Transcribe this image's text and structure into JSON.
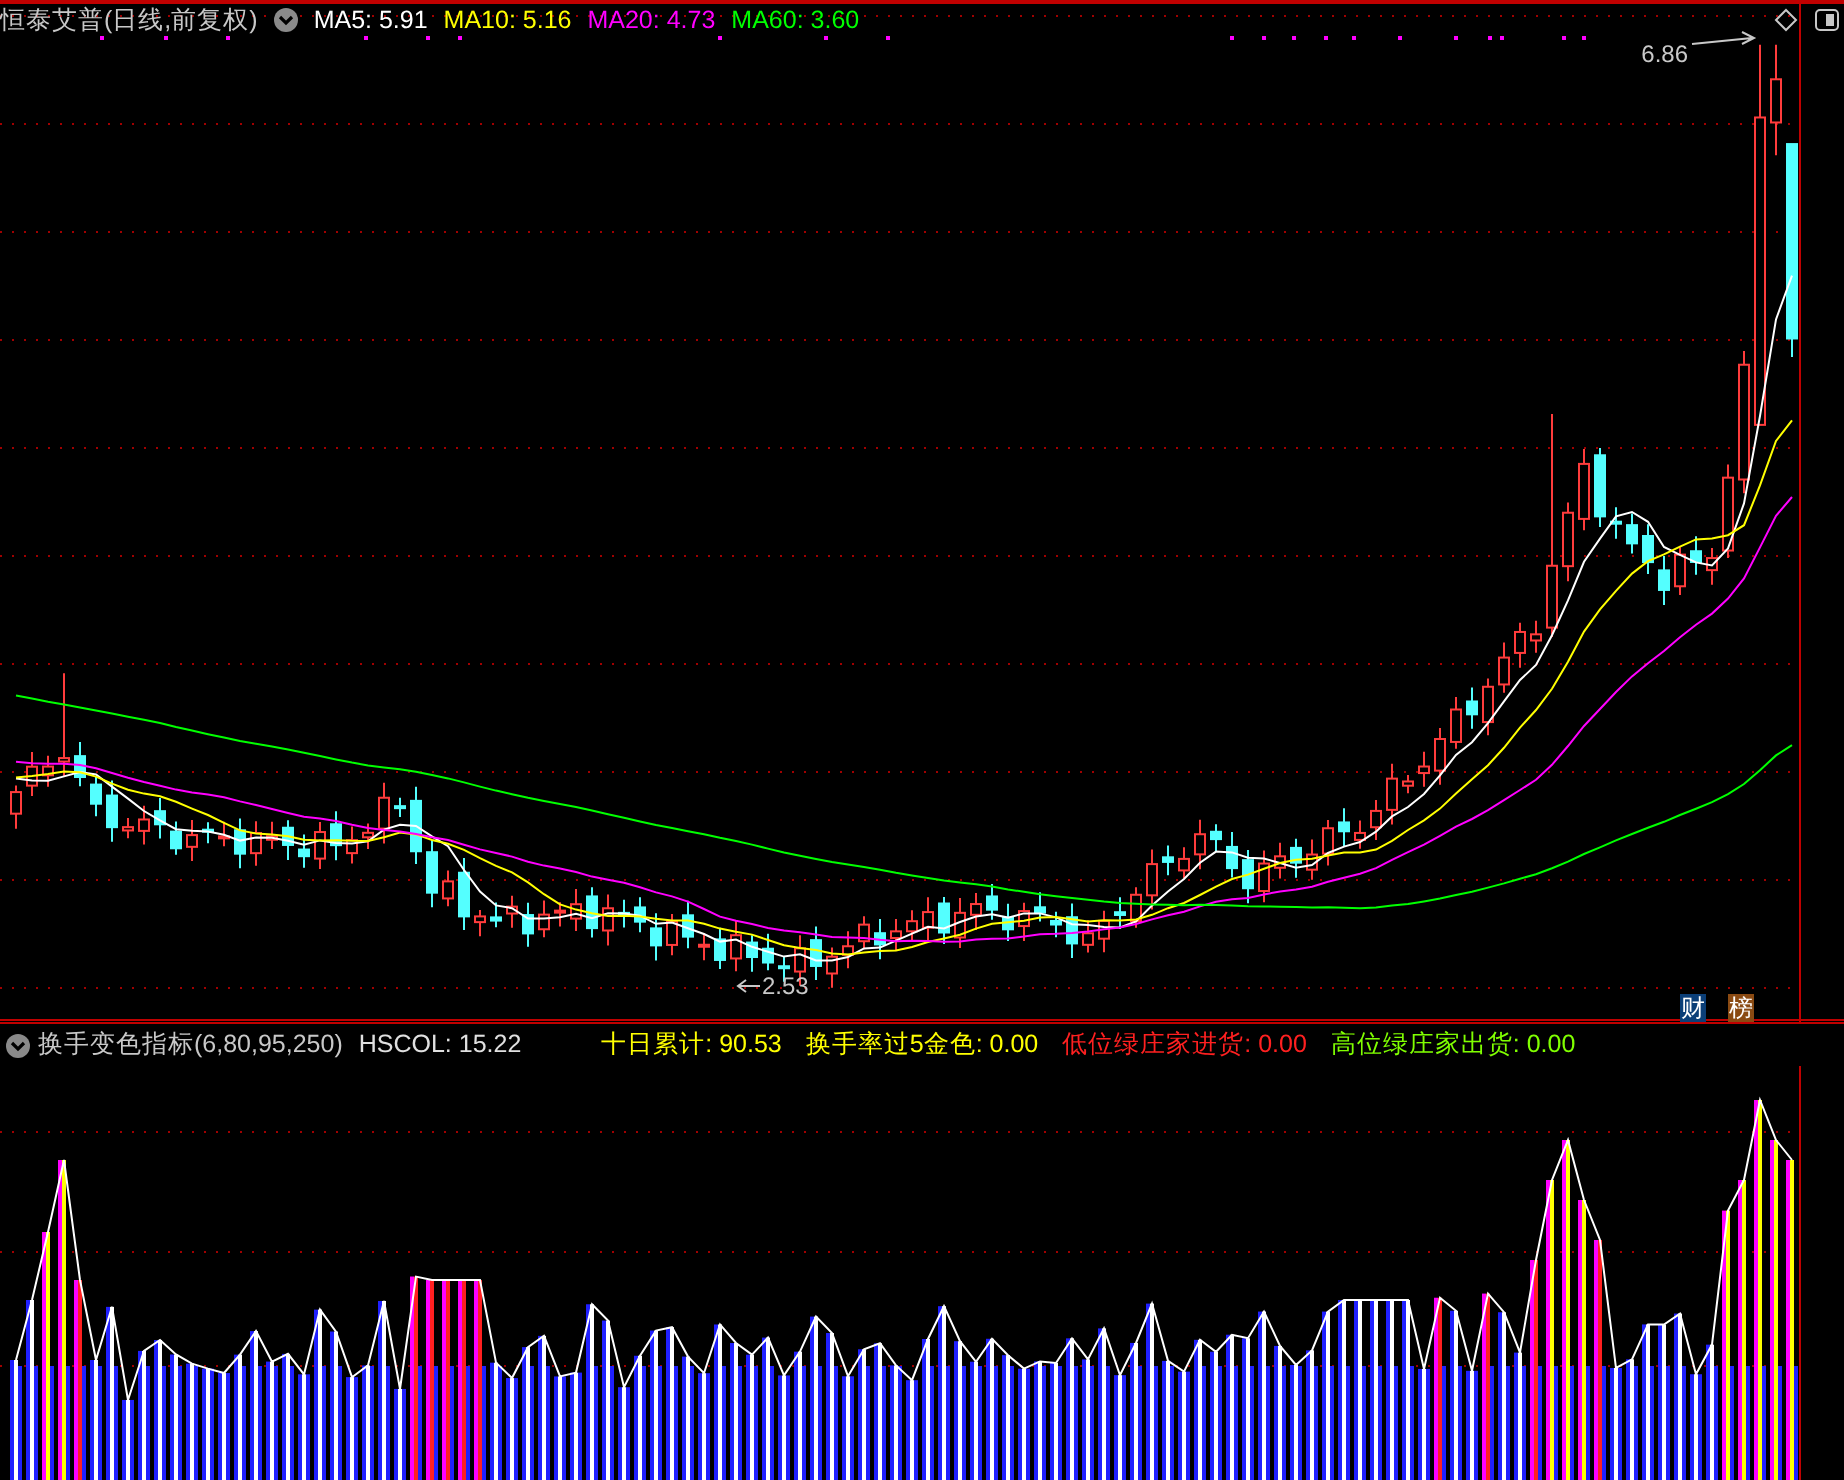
{
  "chart_header": {
    "title": "恒泰艾普(日线,前复权)",
    "moving_averages": [
      {
        "text": "MA5: 5.91",
        "color": "#ffffff"
      },
      {
        "text": "MA10: 5.16",
        "color": "#ffff00"
      },
      {
        "text": "MA20: 4.73",
        "color": "#ff00ff"
      },
      {
        "text": "MA60: 3.60",
        "color": "#00ff00"
      }
    ]
  },
  "price_labels": {
    "high": "6.86",
    "low": "2.53"
  },
  "badges": [
    {
      "text": "财",
      "color": "#0b3f78"
    },
    {
      "text": "榜",
      "color": "#8a4a12"
    }
  ],
  "indicator_header": {
    "title": "换手变色指标(6,80,95,250)",
    "hscol": "HSCOL: 15.22",
    "values": [
      {
        "text": "十日累计: 90.53",
        "color": "#ffff00"
      },
      {
        "text": "换手率过5金色: 0.00",
        "color": "#ffff00"
      },
      {
        "text": "低位绿庄家进货: 0.00",
        "color": "#ff2020"
      },
      {
        "text": "高位绿庄家出货: 0.00",
        "color": "#80ff00"
      }
    ]
  }
}
